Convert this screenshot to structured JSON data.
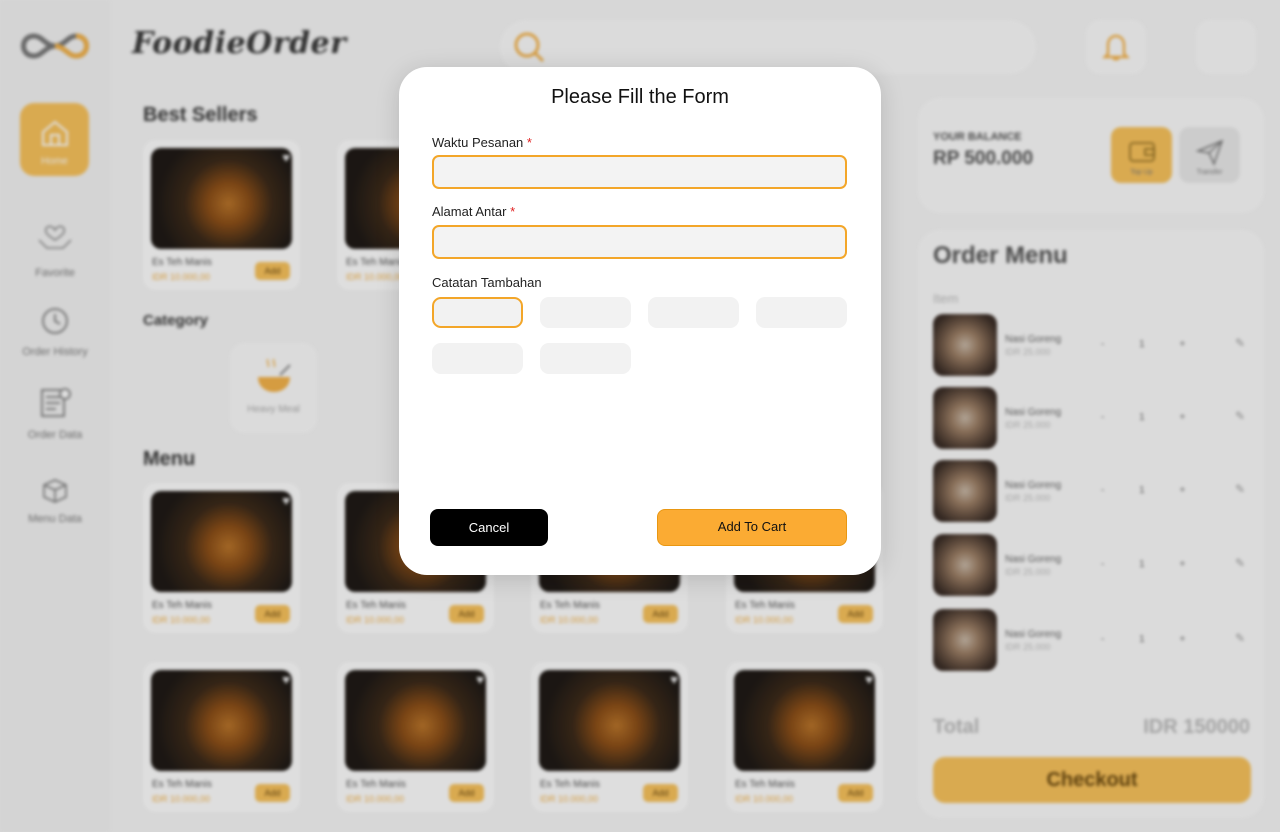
{
  "app": {
    "brand": "FoodieOrder",
    "sidebar": {
      "items": [
        {
          "label": "Home"
        },
        {
          "label": "Favorite"
        },
        {
          "label": "Order History"
        },
        {
          "label": "Order Data"
        },
        {
          "label": "Menu Data"
        }
      ]
    },
    "sections": {
      "best_sellers": "Best Sellers",
      "category": "Category",
      "menu": "Menu"
    },
    "category_items": [
      {
        "label": "Heavy Meal"
      }
    ],
    "product": {
      "name": "Es Teh Manis",
      "price": "IDR 10.000,00",
      "add_label": "Add"
    },
    "balance": {
      "label": "YOUR BALANCE",
      "amount": "RP 500.000",
      "topup_label": "Top Up",
      "transfer_label": "Transfer"
    },
    "order": {
      "title": "Order Menu",
      "item_header": "Item",
      "items": [
        {
          "name": "Nasi Goreng",
          "price": "IDR 25.000",
          "qty": "- 1 +"
        },
        {
          "name": "Nasi Goreng",
          "price": "IDR 25.000",
          "qty": "- 1 +"
        },
        {
          "name": "Nasi Goreng",
          "price": "IDR 25.000",
          "qty": "- 1 +"
        },
        {
          "name": "Nasi Goreng",
          "price": "IDR 25.000",
          "qty": "- 1 +"
        },
        {
          "name": "Nasi Goreng",
          "price": "IDR 25.000",
          "qty": "- 1 +"
        }
      ],
      "total_label": "Total",
      "total_value": "IDR 150000",
      "checkout_label": "Checkout"
    }
  },
  "modal": {
    "title": "Please Fill the Form",
    "fields": {
      "waktu": {
        "label": "Waktu Pesanan",
        "required_mark": "*",
        "value": ""
      },
      "alamat": {
        "label": "Alamat Antar",
        "required_mark": "*",
        "value": ""
      }
    },
    "notes": {
      "label": "Catatan Tambahan",
      "chips": [
        "",
        "",
        "",
        "",
        "",
        ""
      ]
    },
    "cancel_label": "Cancel",
    "add_label": "Add To Cart"
  },
  "colors": {
    "accent": "#fbab33",
    "accent_border": "#f3a629",
    "required": "#e02020"
  }
}
